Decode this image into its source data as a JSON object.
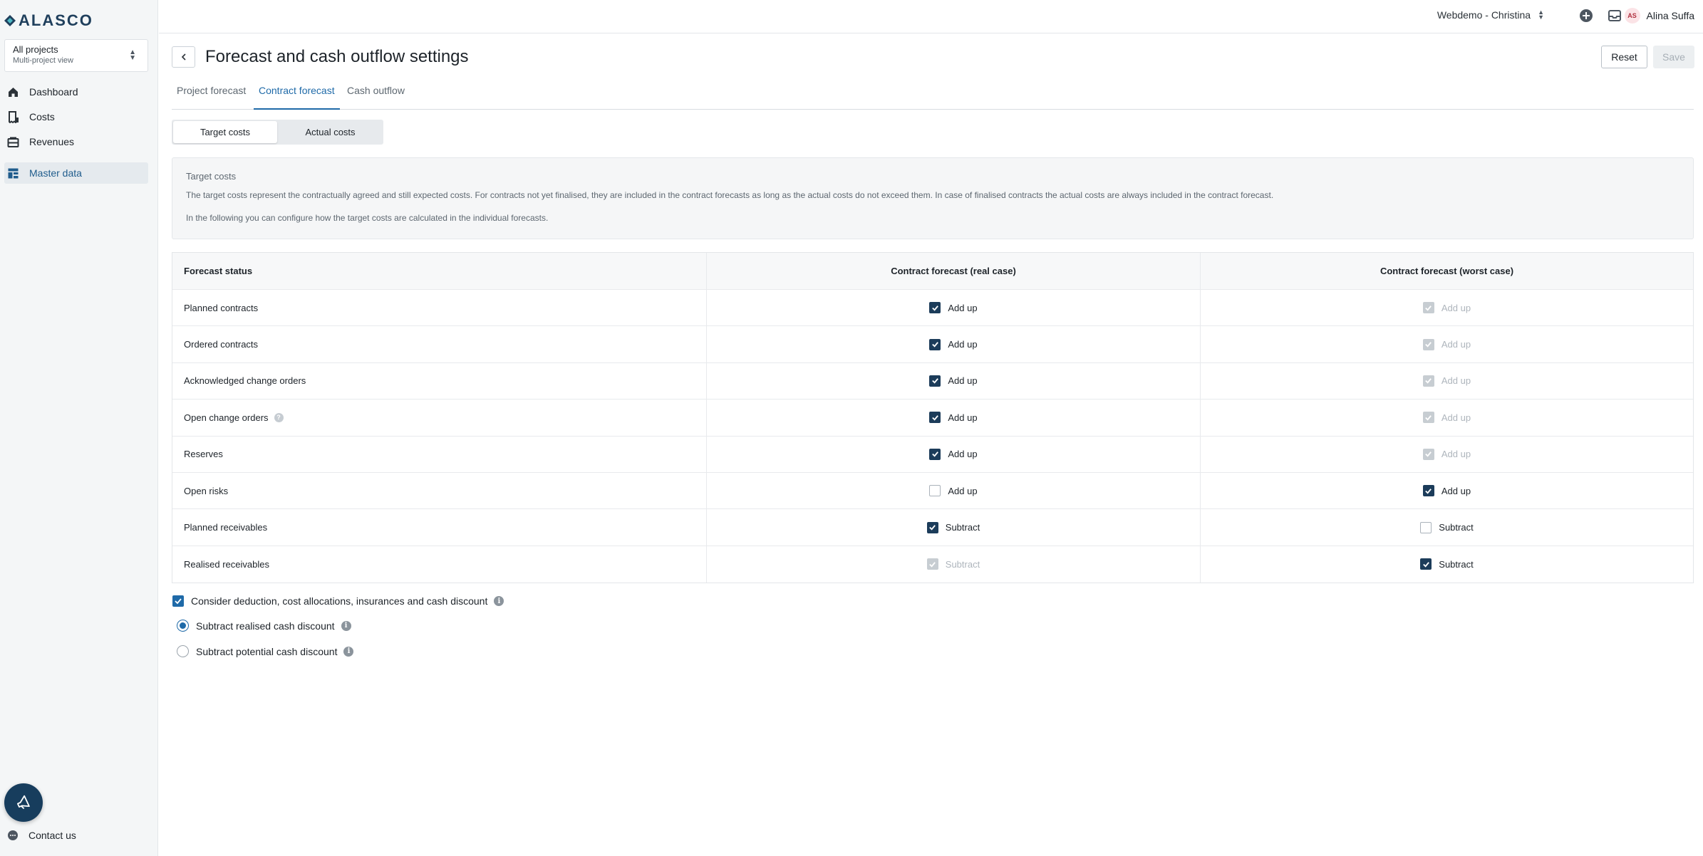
{
  "brand": {
    "name": "ALASCO"
  },
  "project_selector": {
    "title": "All projects",
    "subtitle": "Multi-project view"
  },
  "sidebar": {
    "items": [
      {
        "label": "Dashboard",
        "icon": "home-icon"
      },
      {
        "label": "Costs",
        "icon": "receipt-icon"
      },
      {
        "label": "Revenues",
        "icon": "wallet-icon"
      },
      {
        "label": "Master data",
        "icon": "master-data-icon",
        "active": true
      }
    ],
    "contact_label": "Contact us"
  },
  "topbar": {
    "company": "Webdemo - Christina",
    "user_initials": "AS",
    "user_name": "Alina Suffa"
  },
  "page": {
    "title": "Forecast and cash outflow settings",
    "reset_label": "Reset",
    "save_label": "Save"
  },
  "tabs": [
    {
      "label": "Project forecast"
    },
    {
      "label": "Contract forecast",
      "active": true
    },
    {
      "label": "Cash outflow"
    }
  ],
  "segment": {
    "target_label": "Target costs",
    "actual_label": "Actual costs",
    "active": "target"
  },
  "info": {
    "title": "Target costs",
    "paragraph1": "The target costs represent the contractually agreed and still expected costs. For contracts not yet finalised, they are included in the contract forecasts as long as the actual costs do not exceed them. In case of finalised contracts the actual costs are always included in the contract forecast.",
    "paragraph2": "In the following you can configure how the target costs are calculated in the individual forecasts."
  },
  "table": {
    "headers": [
      "Forecast status",
      "Contract forecast (real case)",
      "Contract forecast (worst case)"
    ],
    "rows": [
      {
        "status": "Planned contracts",
        "real": {
          "label": "Add up",
          "state": "checked"
        },
        "worst": {
          "label": "Add up",
          "state": "disabled"
        }
      },
      {
        "status": "Ordered contracts",
        "real": {
          "label": "Add up",
          "state": "checked"
        },
        "worst": {
          "label": "Add up",
          "state": "disabled"
        }
      },
      {
        "status": "Acknowledged change orders",
        "real": {
          "label": "Add up",
          "state": "checked"
        },
        "worst": {
          "label": "Add up",
          "state": "disabled"
        }
      },
      {
        "status": "Open change orders",
        "help": true,
        "real": {
          "label": "Add up",
          "state": "checked"
        },
        "worst": {
          "label": "Add up",
          "state": "disabled"
        }
      },
      {
        "status": "Reserves",
        "real": {
          "label": "Add up",
          "state": "checked"
        },
        "worst": {
          "label": "Add up",
          "state": "disabled"
        }
      },
      {
        "status": "Open risks",
        "real": {
          "label": "Add up",
          "state": "unchecked"
        },
        "worst": {
          "label": "Add up",
          "state": "checked"
        }
      },
      {
        "status": "Planned receivables",
        "real": {
          "label": "Subtract",
          "state": "checked"
        },
        "worst": {
          "label": "Subtract",
          "state": "unchecked"
        }
      },
      {
        "status": "Realised receivables",
        "real": {
          "label": "Subtract",
          "state": "disabled"
        },
        "worst": {
          "label": "Subtract",
          "state": "checked"
        }
      }
    ]
  },
  "options": {
    "consider_label": "Consider deduction, cost allocations, insurances and cash discount",
    "realised_label": "Subtract realised cash discount",
    "potential_label": "Subtract potential cash discount"
  },
  "colors": {
    "accent": "#1f6aa8",
    "navy": "#1c3c5a"
  }
}
